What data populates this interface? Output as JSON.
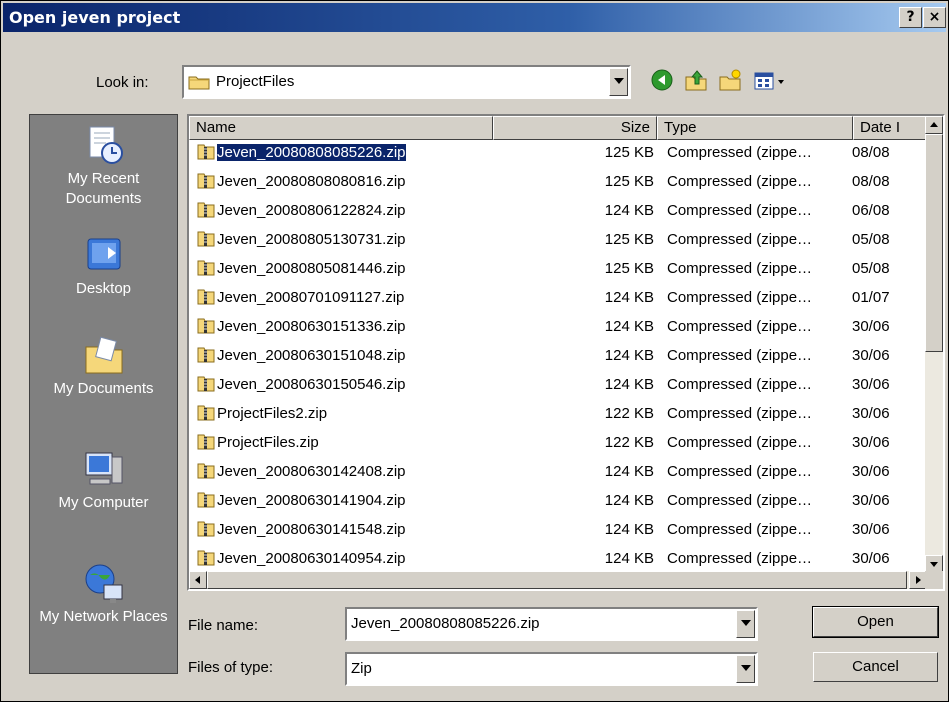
{
  "window": {
    "title": "Open jeven project",
    "help_label": "?",
    "close_label": "×"
  },
  "lookin": {
    "label": "Look in:",
    "value": "ProjectFiles"
  },
  "nav_icons": [
    "back-icon",
    "up-folder-icon",
    "new-folder-icon",
    "view-menu-icon"
  ],
  "places": [
    {
      "label": "My Recent Documents",
      "icon": "recent-documents-icon"
    },
    {
      "label": "Desktop",
      "icon": "desktop-icon"
    },
    {
      "label": "My Documents",
      "icon": "my-documents-icon"
    },
    {
      "label": "My Computer",
      "icon": "my-computer-icon"
    },
    {
      "label": "My Network Places",
      "icon": "network-places-icon"
    }
  ],
  "columns": {
    "name": "Name",
    "size": "Size",
    "type": "Type",
    "date": "Date I"
  },
  "files": [
    {
      "name": "Jeven_20080808085226.zip",
      "size": "125 KB",
      "type": "Compressed (zippe…",
      "date": "08/08",
      "selected": true
    },
    {
      "name": "Jeven_20080808080816.zip",
      "size": "125 KB",
      "type": "Compressed (zippe…",
      "date": "08/08"
    },
    {
      "name": "Jeven_20080806122824.zip",
      "size": "124 KB",
      "type": "Compressed (zippe…",
      "date": "06/08"
    },
    {
      "name": "Jeven_20080805130731.zip",
      "size": "125 KB",
      "type": "Compressed (zippe…",
      "date": "05/08"
    },
    {
      "name": "Jeven_20080805081446.zip",
      "size": "125 KB",
      "type": "Compressed (zippe…",
      "date": "05/08"
    },
    {
      "name": "Jeven_20080701091127.zip",
      "size": "124 KB",
      "type": "Compressed (zippe…",
      "date": "01/07"
    },
    {
      "name": "Jeven_20080630151336.zip",
      "size": "124 KB",
      "type": "Compressed (zippe…",
      "date": "30/06"
    },
    {
      "name": "Jeven_20080630151048.zip",
      "size": "124 KB",
      "type": "Compressed (zippe…",
      "date": "30/06"
    },
    {
      "name": "Jeven_20080630150546.zip",
      "size": "124 KB",
      "type": "Compressed (zippe…",
      "date": "30/06"
    },
    {
      "name": "ProjectFiles2.zip",
      "size": "122 KB",
      "type": "Compressed (zippe…",
      "date": "30/06"
    },
    {
      "name": "ProjectFiles.zip",
      "size": "122 KB",
      "type": "Compressed (zippe…",
      "date": "30/06"
    },
    {
      "name": "Jeven_20080630142408.zip",
      "size": "124 KB",
      "type": "Compressed (zippe…",
      "date": "30/06"
    },
    {
      "name": "Jeven_20080630141904.zip",
      "size": "124 KB",
      "type": "Compressed (zippe…",
      "date": "30/06"
    },
    {
      "name": "Jeven_20080630141548.zip",
      "size": "124 KB",
      "type": "Compressed (zippe…",
      "date": "30/06"
    },
    {
      "name": "Jeven_20080630140954.zip",
      "size": "124 KB",
      "type": "Compressed (zippe…",
      "date": "30/06"
    }
  ],
  "filename": {
    "label": "File name:",
    "value": "Jeven_20080808085226.zip"
  },
  "filetype": {
    "label": "Files of type:",
    "value": "Zip"
  },
  "buttons": {
    "open": "Open",
    "cancel": "Cancel"
  },
  "colors": {
    "title_bar": "#0a246a",
    "selection": "#0a246a",
    "places_bar": "#808080",
    "face": "#d4d0c8"
  }
}
